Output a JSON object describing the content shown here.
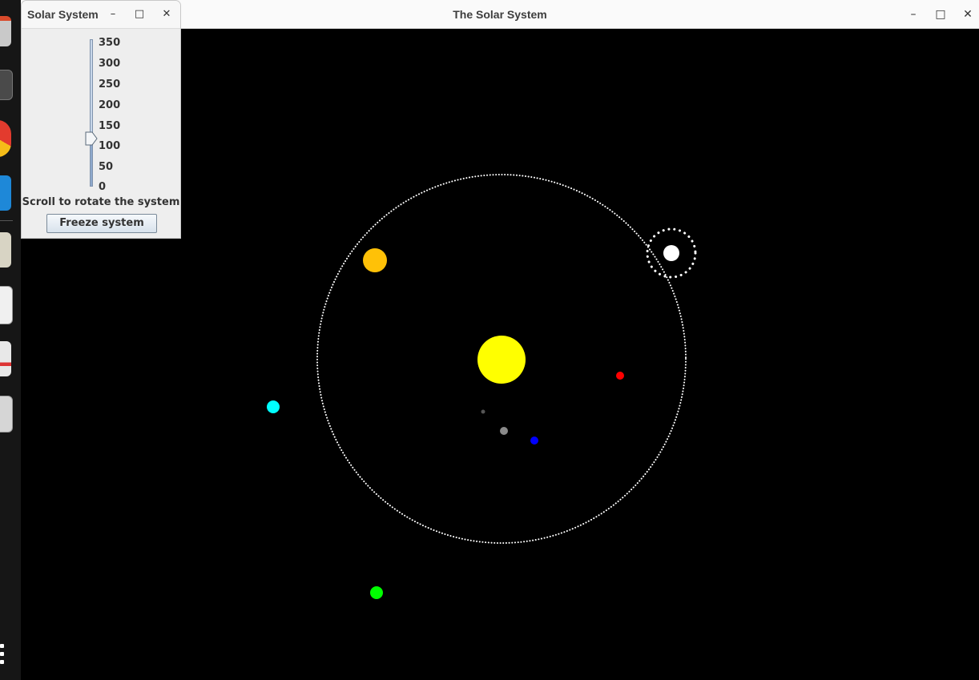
{
  "main_window": {
    "title": "The Solar System",
    "controls": {
      "minimize": "–",
      "maximize": "□",
      "close": "✕"
    }
  },
  "control_window": {
    "title": "Solar System",
    "controls": {
      "minimize": "–",
      "maximize": "□",
      "close": "✕"
    },
    "slider": {
      "min": 0,
      "max": 350,
      "value": 115,
      "tick_labels": [
        "350",
        "300",
        "250",
        "200",
        "150",
        "100",
        "50",
        "0"
      ]
    },
    "hint": "Scroll to rotate the system",
    "freeze_button": "Freeze system"
  },
  "scene": {
    "background": "#000000",
    "sun": {
      "name": "sun",
      "color": "#ffff00"
    },
    "bodies": [
      {
        "name": "body-gray-small",
        "color": "#555555"
      },
      {
        "name": "body-gray",
        "color": "#8a8a8a"
      },
      {
        "name": "body-blue",
        "color": "#0000ff"
      },
      {
        "name": "body-red",
        "color": "#ff0000"
      },
      {
        "name": "body-orange",
        "color": "#ffc107"
      },
      {
        "name": "body-white",
        "color": "#ffffff"
      },
      {
        "name": "body-cyan",
        "color": "#00ffff"
      },
      {
        "name": "body-green",
        "color": "#00ff00"
      }
    ],
    "orbit_color": "#ffffff"
  },
  "dock": {
    "icons": [
      "files-icon",
      "terminal-icon",
      "chrome-icon",
      "vscode-icon",
      "document-icon",
      "inkscape-icon",
      "calendar-icon",
      "usb-icon"
    ],
    "apps_grid": "apps-grid-icon"
  }
}
